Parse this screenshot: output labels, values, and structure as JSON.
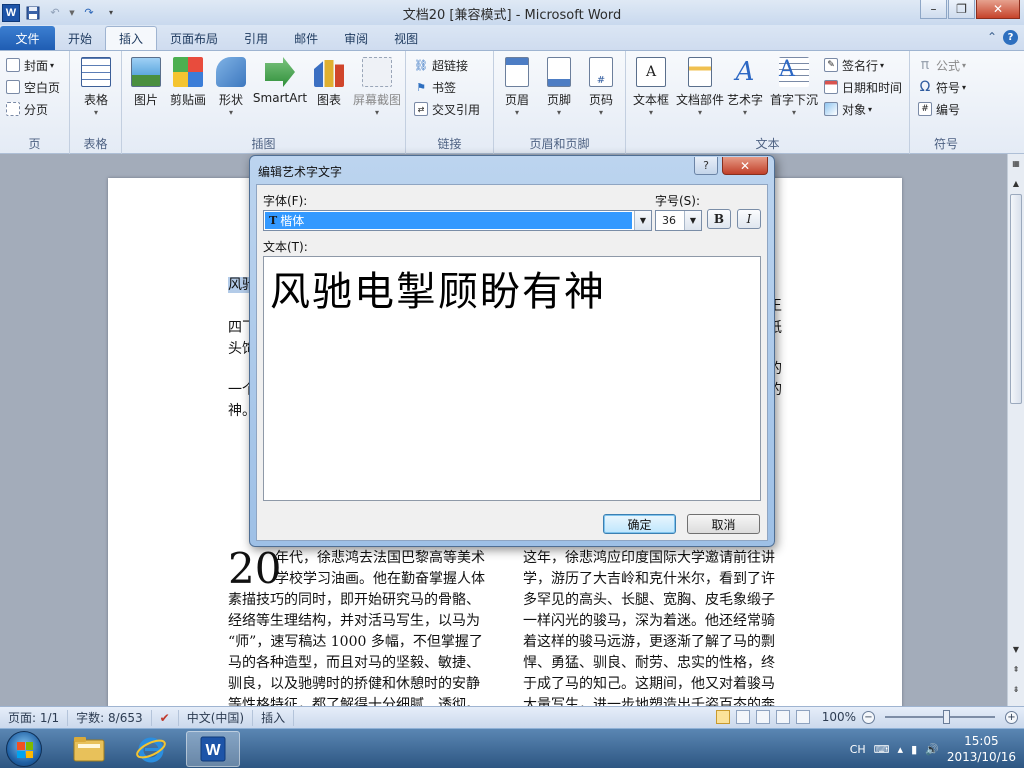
{
  "window": {
    "title": "文档20 [兼容模式] - Microsoft Word",
    "app_icon": "W",
    "controls": [
      "–",
      "❐",
      "✕"
    ]
  },
  "tabs": [
    {
      "label": "文件",
      "type": "file"
    },
    {
      "label": "开始"
    },
    {
      "label": "插入",
      "active": true
    },
    {
      "label": "页面布局"
    },
    {
      "label": "引用"
    },
    {
      "label": "邮件"
    },
    {
      "label": "审阅"
    },
    {
      "label": "视图"
    }
  ],
  "ribbon": {
    "pages": {
      "label": "页",
      "items": [
        "封面",
        "空白页",
        "分页"
      ]
    },
    "tables": {
      "label": "表格",
      "button": "表格"
    },
    "illustrations": {
      "label": "插图",
      "buttons": [
        "图片",
        "剪贴画",
        "形状",
        "SmartArt",
        "图表",
        "屏幕截图"
      ]
    },
    "links": {
      "label": "链接",
      "items": [
        "超链接",
        "书签",
        "交叉引用"
      ]
    },
    "header_footer": {
      "label": "页眉和页脚",
      "buttons": [
        "页眉",
        "页脚",
        "页码"
      ]
    },
    "text": {
      "label": "文本",
      "buttons": [
        "文本框",
        "文档部件",
        "艺术字",
        "首字下沉"
      ],
      "items": [
        "签名行",
        "日期和时间",
        "对象"
      ]
    },
    "symbols": {
      "label": "符号",
      "items": [
        "公式",
        "符号",
        "编号"
      ]
    }
  },
  "document": {
    "top_left_1": "风驰",
    "left_lines": [
      "四飞",
      "头饰",
      "一个",
      "神。"
    ],
    "right_marks": [
      "王",
      "纸",
      "的",
      "的"
    ],
    "dropcap": "20",
    "col1": [
      "年代，徐悲鸿去法国巴黎高等美术",
      "学校学习油画。他在勤奋掌握人体",
      "素描技巧的同时，即开始研究马的骨骼、",
      "经络等生理结构，并对活马写生，以马为",
      "“师”，速写稿达 1000 多幅，不但掌握了",
      "马的各种造型，而且对马的坚毅、敏捷、",
      "驯良，以及驰骋时的挢健和休憩时的安静",
      "等性格特征，都了解得十分细腻、透彻。"
    ],
    "col2": [
      "这年，徐悲鸿应印度国际大学邀请前往讲",
      "学，游历了大吉岭和克什米尔，看到了许",
      "多罕见的高头、长腿、宽胸、皮毛象缎子",
      "一样闪光的骏马，深为着迷。他还经常骑",
      "着这样的骏马远游，更逐渐了解了马的剽",
      "悍、勇猛、驯良、耐劳、忠实的性格，终",
      "于成了马的知己。这期间，他又对着骏马",
      "大量写生，进一步地塑造出千姿百态的奔"
    ]
  },
  "dialog": {
    "title": "编辑艺术字文字",
    "help": "?",
    "close": "✕",
    "font_label": "字体(F):",
    "font_value": "楷体",
    "font_value_prefix": "T",
    "size_label": "字号(S):",
    "size_value": "36",
    "bold_label": "B",
    "italic_label": "I",
    "text_label": "文本(T):",
    "text_value": "风驰电掣顾盼有神",
    "ok": "确定",
    "cancel": "取消"
  },
  "status": {
    "page": "页面: 1/1",
    "words": "字数: 8/653",
    "language": "中文(中国)",
    "mode": "插入",
    "zoom": "100%"
  },
  "taskbar": {
    "tray_lang": "CH",
    "time": "15:05",
    "date": "2013/10/16"
  },
  "colors": {
    "accent": "#1f5db3",
    "selection": "#3399ff"
  }
}
